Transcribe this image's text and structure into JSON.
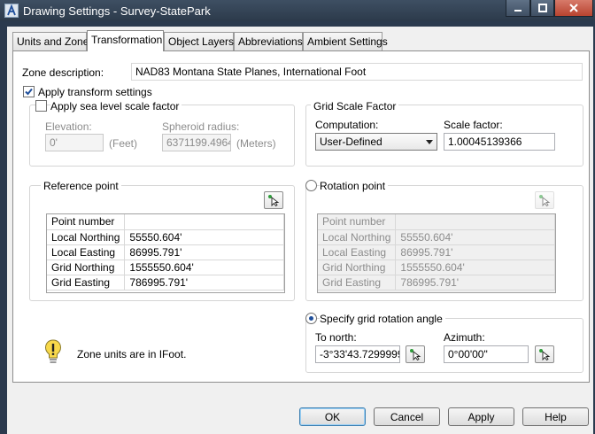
{
  "window": {
    "title": "Drawing Settings - Survey-StatePark"
  },
  "tabs": [
    "Units and Zone",
    "Transformation",
    "Object Layers",
    "Abbreviations",
    "Ambient Settings"
  ],
  "zone": {
    "label": "Zone description:",
    "value": "NAD83 Montana State Planes, International Foot"
  },
  "apply_transform": {
    "label": "Apply transform settings",
    "checked": true
  },
  "sea_level": {
    "label": "Apply sea level scale factor",
    "elevation_label": "Elevation:",
    "elevation_value": "0'",
    "elevation_unit": "(Feet)",
    "spheroid_label": "Spheroid radius:",
    "spheroid_value": "6371199.4964",
    "spheroid_unit": "(Meters)"
  },
  "grid_scale": {
    "title": "Grid Scale Factor",
    "computation_label": "Computation:",
    "computation_value": "User-Defined",
    "scale_label": "Scale factor:",
    "scale_value": "1.00045139366"
  },
  "reference_point": {
    "title": "Reference point",
    "rows": [
      [
        "Point number",
        ""
      ],
      [
        "Local Northing",
        "55550.604'"
      ],
      [
        "Local Easting",
        "86995.791'"
      ],
      [
        "Grid Northing",
        "1555550.604'"
      ],
      [
        "Grid Easting",
        "786995.791'"
      ]
    ]
  },
  "rotation_point": {
    "title": "Rotation point",
    "rows": [
      [
        "Point number",
        ""
      ],
      [
        "Local Northing",
        "55550.604'"
      ],
      [
        "Local Easting",
        "86995.791'"
      ],
      [
        "Grid Northing",
        "1555550.604'"
      ],
      [
        "Grid Easting",
        "786995.791'"
      ]
    ]
  },
  "grid_rotation": {
    "title": "Specify grid rotation angle",
    "to_north_label": "To north:",
    "to_north_value": "-3°33'43.7299999",
    "azimuth_label": "Azimuth:",
    "azimuth_value": "0°00'00\""
  },
  "info": {
    "text": "Zone units are in IFoot."
  },
  "buttons": {
    "ok": "OK",
    "cancel": "Cancel",
    "apply": "Apply",
    "help": "Help"
  },
  "colors": {
    "titlebar": "#34445a",
    "accent": "#1f4f9b"
  }
}
